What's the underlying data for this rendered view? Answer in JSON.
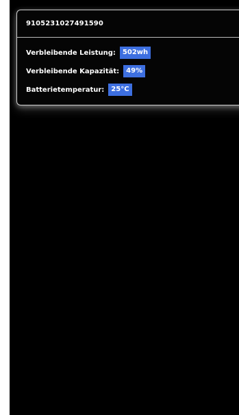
{
  "device": {
    "serial": "9105231027491590"
  },
  "stats": [
    {
      "label": "Verbleibende Leistung:",
      "value": "502wh"
    },
    {
      "label": "Verbleibende Kapazität:",
      "value": "49%"
    },
    {
      "label": "Batterietemperatur:",
      "value": "25°C"
    }
  ],
  "colors": {
    "background": "#000000",
    "badge": "#3d6fe0",
    "text": "#ffffff",
    "border": "#cfcfcf"
  }
}
